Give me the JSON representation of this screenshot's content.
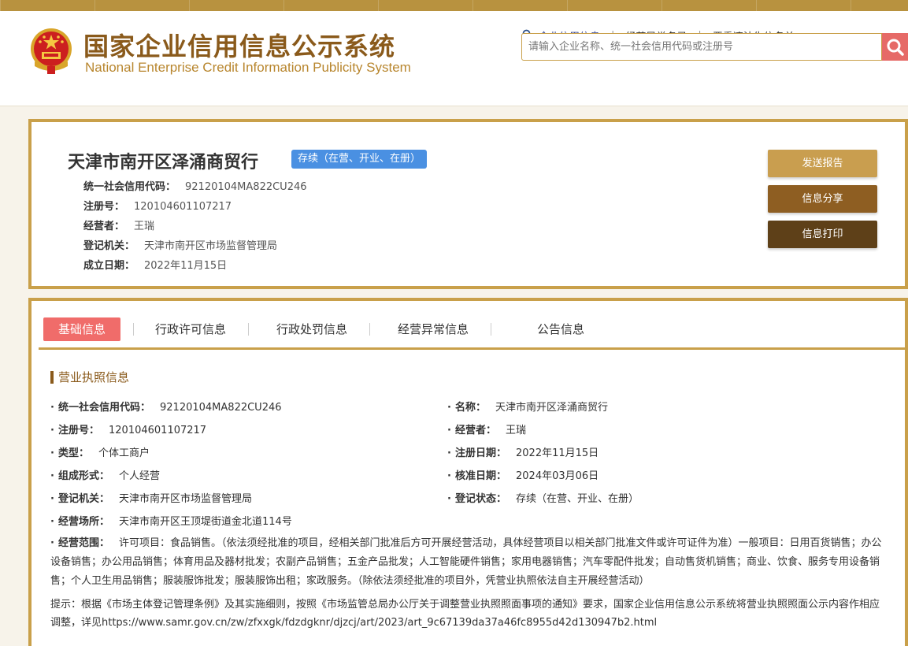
{
  "header": {
    "title_cn": "国家企业信用信息公示系统",
    "title_en": "National Enterprise Credit Information Publicity System",
    "nav": {
      "credit_info": "企业信用信息",
      "abnormal_list": "经营异常名录",
      "serious_violation": "严重违法失信名单"
    },
    "search": {
      "placeholder": "请输入企业名称、统一社会信用代码或注册号"
    }
  },
  "company": {
    "name": "天津市南开区泽涌商贸行",
    "status": "存续（在营、开业、在册）",
    "rows": [
      {
        "label": "统一社会信用代码：",
        "value": "92120104MA822CU246"
      },
      {
        "label": "注册号：",
        "value": "120104601107217"
      },
      {
        "label": "经营者：",
        "value": "王瑞"
      },
      {
        "label": "登记机关：",
        "value": "天津市南开区市场监督管理局"
      },
      {
        "label": "成立日期：",
        "value": "2022年11月15日"
      }
    ],
    "buttons": {
      "report": "发送报告",
      "share": "信息分享",
      "print": "信息打印"
    }
  },
  "tabs": [
    "基础信息",
    "行政许可信息",
    "行政处罚信息",
    "经营异常信息",
    "公告信息"
  ],
  "license": {
    "section_title": "营业执照信息",
    "left": [
      {
        "label": "统一社会信用代码：",
        "value": "92120104MA822CU246"
      },
      {
        "label": "注册号：",
        "value": "120104601107217"
      },
      {
        "label": "类型：",
        "value": "个体工商户"
      },
      {
        "label": "组成形式：",
        "value": "个人经营"
      },
      {
        "label": "登记机关：",
        "value": "天津市南开区市场监督管理局"
      },
      {
        "label": "经营场所：",
        "value": "天津市南开区王顶堤街道金北道114号"
      }
    ],
    "right": [
      {
        "label": "名称：",
        "value": "天津市南开区泽涌商贸行"
      },
      {
        "label": "经营者：",
        "value": "王瑞"
      },
      {
        "label": "注册日期：",
        "value": "2022年11月15日"
      },
      {
        "label": "核准日期：",
        "value": "2024年03月06日"
      },
      {
        "label": "登记状态：",
        "value": "存续（在营、开业、在册）"
      }
    ],
    "scope_label": "经营范围：",
    "scope_value": "许可项目：食品销售。（依法须经批准的项目，经相关部门批准后方可开展经营活动，具体经营项目以相关部门批准文件或许可证件为准）一般项目：日用百货销售；办公设备销售；办公用品销售；体育用品及器材批发；农副产品销售；五金产品批发；人工智能硬件销售；家用电器销售；汽车零配件批发；自动售货机销售；商业、饮食、服务专用设备销售；个人卫生用品销售；服装服饰批发；服装服饰出租；家政服务。（除依法须经批准的项目外，凭营业执照依法自主开展经营活动）",
    "tip": "提示：根据《市场主体登记管理条例》及其实施细则，按照《市场监管总局办公厅关于调整营业执照照面事项的通知》要求，国家企业信用信息公示系统将营业执照照面公示内容作相应调整，详见https://www.samr.gov.cn/zw/zfxxgk/fdzdgknr/djzcj/art/2023/art_9c67139da37a46fc8955d42d130947b2.html"
  },
  "colors": {
    "gold_border": "#c9a04a",
    "brand_brown": "#8a5a1b",
    "status_blue": "#4a90e2",
    "active_tab": "#f06c6a"
  }
}
